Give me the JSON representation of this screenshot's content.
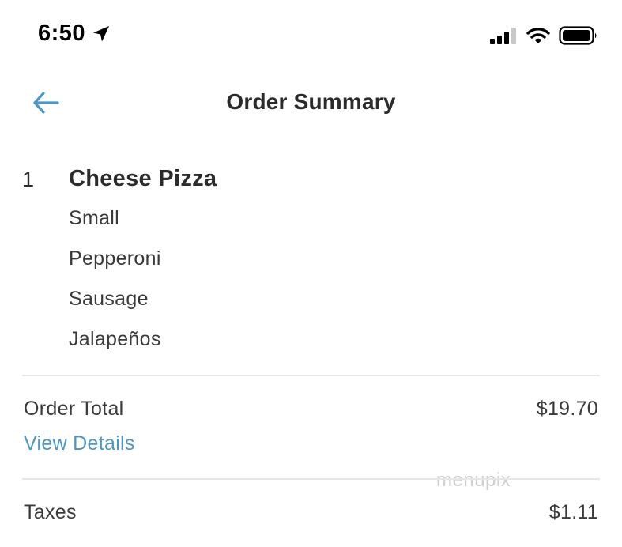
{
  "status_bar": {
    "time": "6:50",
    "icons": [
      "location-arrow-icon",
      "signal-bars-icon",
      "wifi-icon",
      "battery-icon"
    ]
  },
  "header": {
    "title": "Order Summary",
    "back_icon": "back-arrow-icon"
  },
  "order_item": {
    "quantity": "1",
    "name": "Cheese Pizza",
    "modifiers": [
      "Small",
      "Pepperoni",
      "Sausage",
      "Jalapeños"
    ]
  },
  "totals": {
    "order_total_label": "Order Total",
    "order_total_value": "$19.70",
    "view_details_label": "View Details",
    "taxes_label": "Taxes",
    "taxes_value": "$1.11"
  },
  "watermark": "menupix",
  "colors": {
    "accent_link": "#4d97c2",
    "text_primary": "#2b2b2b",
    "divider": "#e6e6e6"
  }
}
